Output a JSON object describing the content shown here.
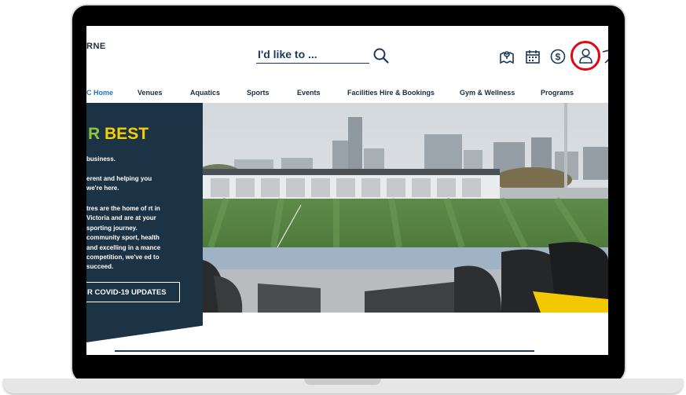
{
  "header": {
    "logo_text": "RNE",
    "search_label": "I'd like to ..."
  },
  "header_icons": [
    "map-pin-icon",
    "calendar-icon",
    "dollar-icon",
    "user-icon",
    "shield-icon"
  ],
  "nav": {
    "items": [
      {
        "label": "Home",
        "prefix": "C",
        "active": true
      },
      {
        "label": "Venues"
      },
      {
        "label": "Aquatics"
      },
      {
        "label": "Sports"
      },
      {
        "label": "Events"
      },
      {
        "label": "Facilities Hire & Bookings"
      },
      {
        "label": "Gym & Wellness"
      },
      {
        "label": "Programs"
      }
    ]
  },
  "hero": {
    "title_green": "R",
    "title_yellow": "BEST",
    "paragraph_1": "business.",
    "paragraph_2": "erent and helping you we're here.",
    "paragraph_3": "tres are the home of rt in Victoria and are at your sporting journey. community sport, health and excelling in a mance competition, we've ed to succeed.",
    "cta_label": "R COVID-19 UPDATES"
  },
  "colors": {
    "navy": "#1c3346",
    "accent_blue": "#1f74c9",
    "yellow": "#f5d000",
    "green": "#8dc63f",
    "highlight_red": "#e30613"
  }
}
